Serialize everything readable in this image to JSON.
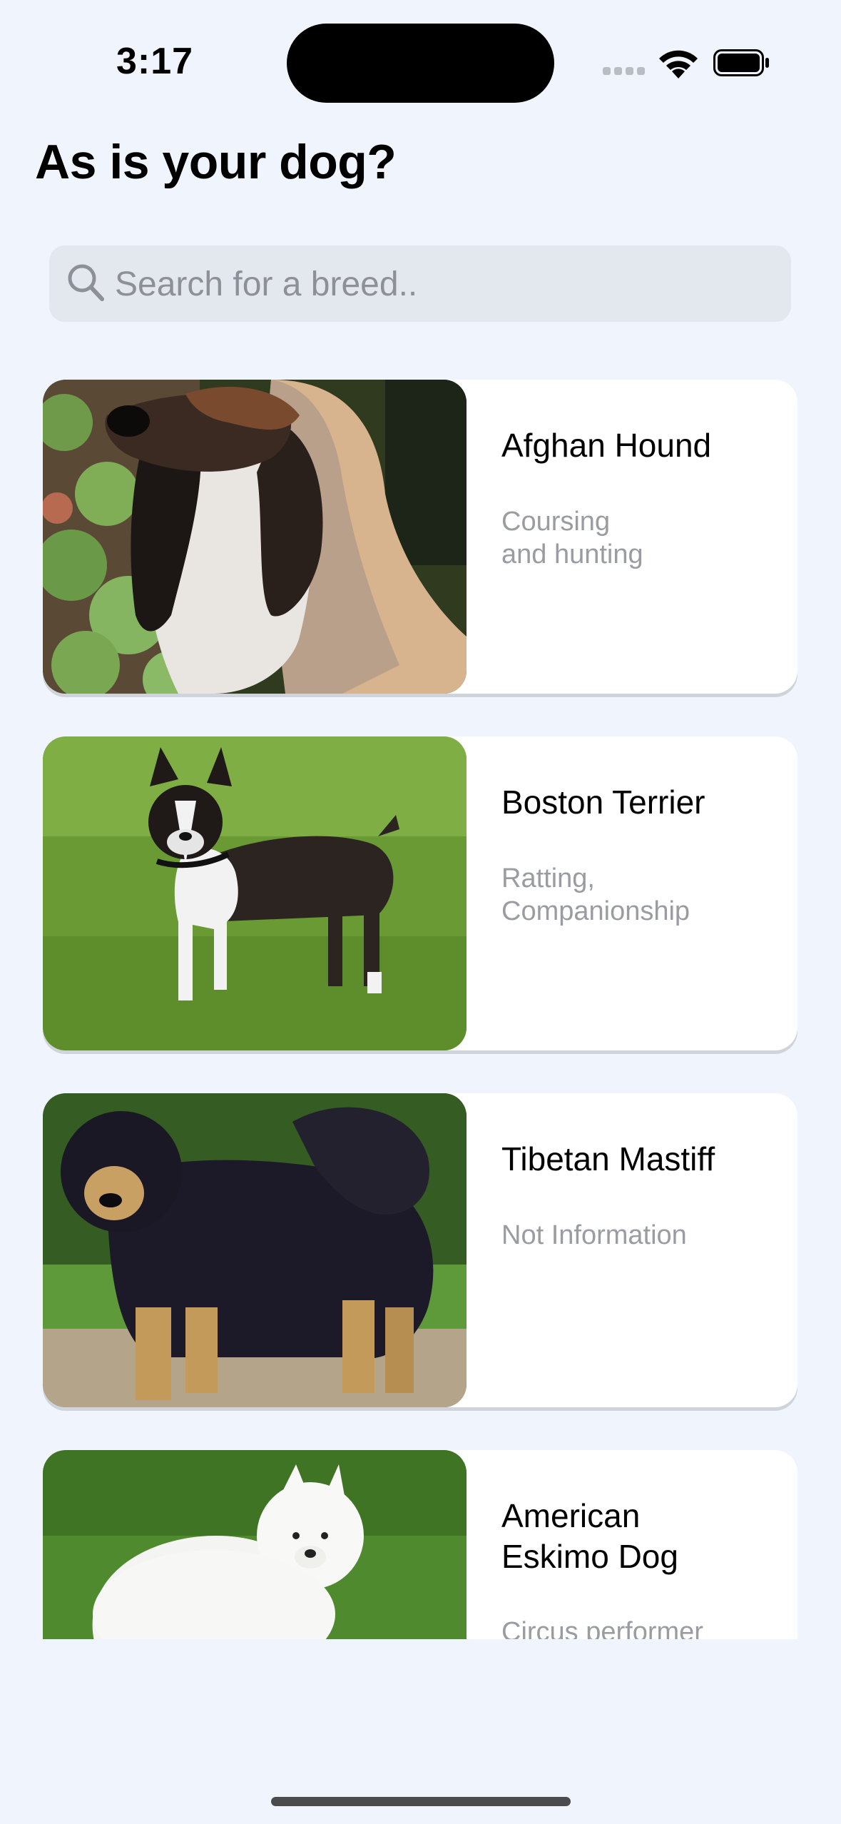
{
  "status_bar": {
    "time": "3:17"
  },
  "header": {
    "title": "As is your dog?"
  },
  "search": {
    "placeholder": "Search for a breed..",
    "value": ""
  },
  "breeds": [
    {
      "name": "Afghan Hound",
      "group": "Coursing\nand hunting",
      "image": "afghan-hound-photo"
    },
    {
      "name": "Boston Terrier",
      "group": "Ratting,\nCompanionship",
      "image": "boston-terrier-photo"
    },
    {
      "name": "Tibetan Mastiff",
      "group": "Not Information",
      "image": "tibetan-mastiff-photo"
    },
    {
      "name": "American\nEskimo Dog",
      "group": "Circus performer",
      "image": "american-eskimo-dog-photo"
    }
  ],
  "colors": {
    "background": "#f0f4fc",
    "card": "#ffffff",
    "secondary_text": "#9a9ca2",
    "search_bg": "#e3e7ee"
  }
}
